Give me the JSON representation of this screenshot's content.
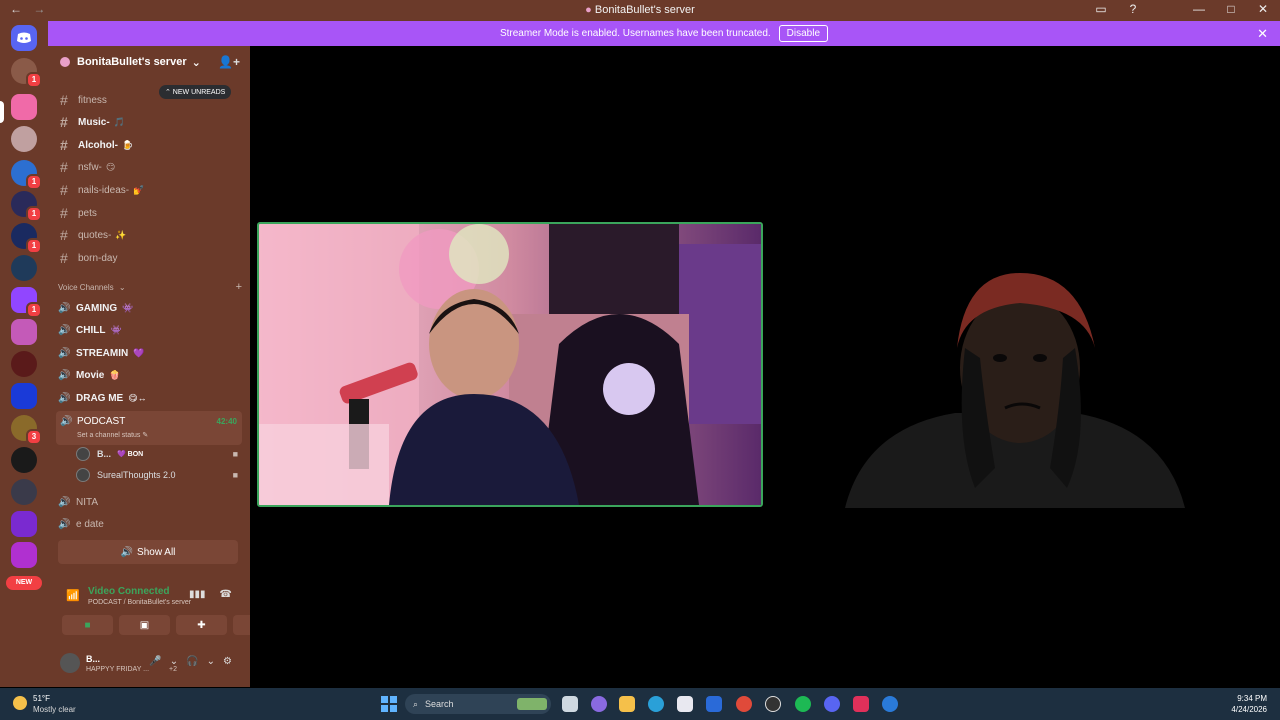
{
  "window": {
    "title": "BonitaBullet's server",
    "back_glyph": "←",
    "forward_glyph": "→",
    "inbox_glyph": "▭",
    "help_glyph": "?",
    "minimize_glyph": "—",
    "maximize_glyph": "□",
    "close_glyph": "✕"
  },
  "server_rail": {
    "badges": [
      "1",
      "1",
      "1",
      "1",
      "1",
      "3"
    ],
    "new_label": "NEW"
  },
  "banner": {
    "message": "Streamer Mode is enabled. Usernames have been truncated.",
    "disable_label": "Disable",
    "close_glyph": "✕"
  },
  "sidebar": {
    "server_name": "BonitaBullet's server",
    "chevron": "⌄",
    "invite_glyph": "👤+",
    "new_unreads": "⌃ NEW UNREADS",
    "text_channels": [
      {
        "name": "fitness",
        "emoji": ""
      },
      {
        "name": "Music-",
        "emoji": "🎵"
      },
      {
        "name": "Alcohol-",
        "emoji": "🍺"
      },
      {
        "name": "nsfw-",
        "emoji": "😏"
      },
      {
        "name": "nails-ideas-",
        "emoji": "💅"
      },
      {
        "name": "pets",
        "emoji": ""
      },
      {
        "name": "quotes-",
        "emoji": "✨"
      },
      {
        "name": "born-day",
        "emoji": ""
      }
    ],
    "voice_category": "Voice Channels",
    "voice_category_plus": "+",
    "voice_channels": [
      {
        "name": "GAMING",
        "emoji": "👾"
      },
      {
        "name": "CHILL",
        "emoji": "👾"
      },
      {
        "name": "STREAMIN",
        "emoji": "💜"
      },
      {
        "name": "Movie",
        "emoji": "🍿"
      },
      {
        "name": "DRAG ME",
        "emoji": "😋↔"
      }
    ],
    "active_voice": {
      "name": "PODCAST",
      "status": "Set a channel status ✎",
      "timer": "42:40",
      "members": [
        {
          "name": "B...",
          "tag": "💜 BON"
        },
        {
          "name": "SurealThoughts 2.0",
          "tag": ""
        }
      ]
    },
    "more_voice": [
      "NITA",
      "e date"
    ],
    "show_all": "Show All"
  },
  "voice_panel": {
    "title": "Video Connected",
    "subtitle": "PODCAST / BonitaBullet's server"
  },
  "user_panel": {
    "name": "B...",
    "status": "HAPPYY FRIDAY ...",
    "extra": "+2"
  },
  "taskbar": {
    "temperature": "51°F",
    "weather": "Mostly clear",
    "search_placeholder": "Search",
    "time": "9:34 PM",
    "date": "4/24/2026"
  }
}
